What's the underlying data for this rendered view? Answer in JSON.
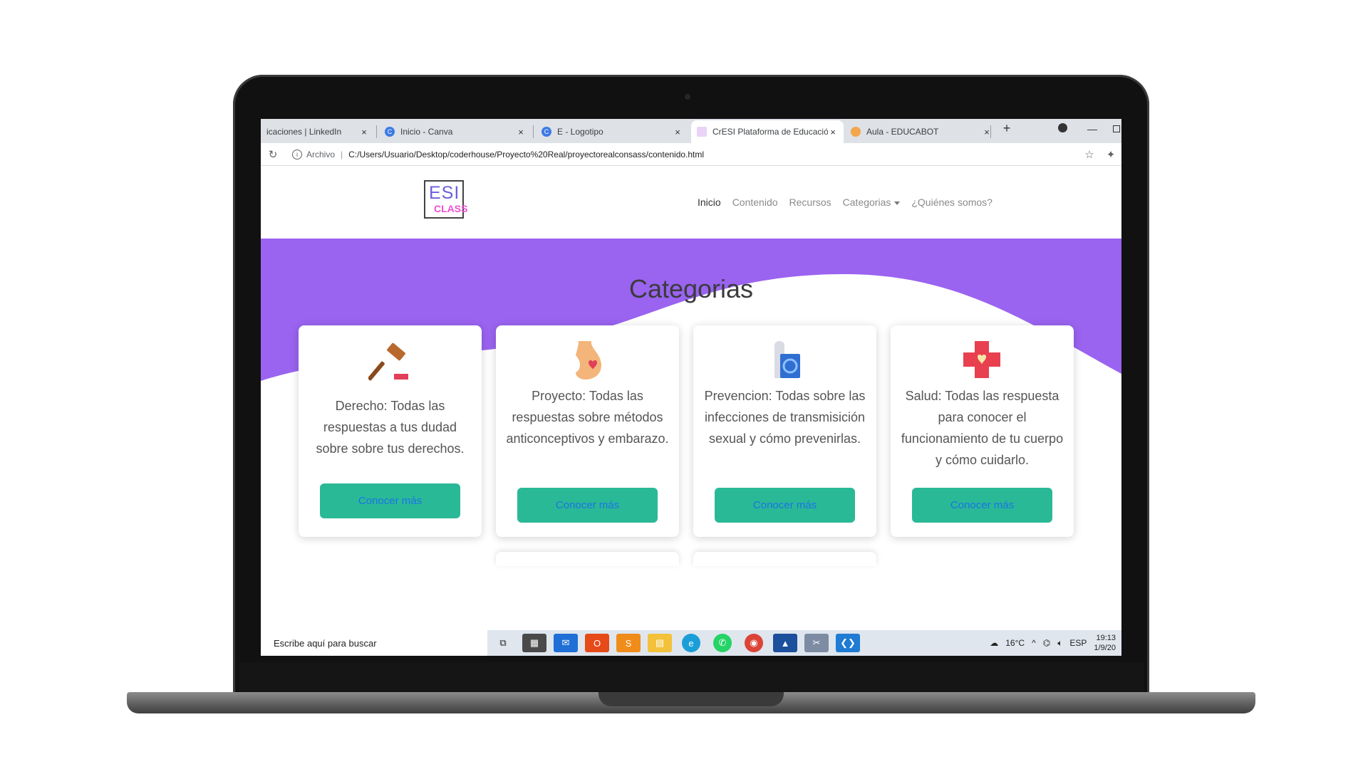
{
  "browser": {
    "tabs": [
      {
        "title": "icaciones | LinkedIn",
        "icon": "linkedin-icon"
      },
      {
        "title": "Inicio - Canva",
        "icon": "canva-icon"
      },
      {
        "title": "E - Logotipo",
        "icon": "canva-icon"
      },
      {
        "title": "CrESI Plataforma de Educació",
        "icon": "page-icon"
      },
      {
        "title": "Aula - EDUCABOT",
        "icon": "educabot-icon"
      }
    ],
    "close_glyph": "×",
    "new_tab": "+",
    "minimize": "—",
    "address": {
      "label": "Archivo",
      "url": "C:/Users/Usuario/Desktop/coderhouse/Proyecto%20Real/proyectorealconsass/contenido.html"
    }
  },
  "site": {
    "logo": {
      "line1": "ESI",
      "line2": "CLASS"
    },
    "nav": {
      "inicio": "Inicio",
      "contenido": "Contenido",
      "recursos": "Recursos",
      "categorias": "Categorias",
      "quienes": "¿Quiénes somos?"
    },
    "hero_color": "#9a63f0",
    "section_title": "Categorias",
    "cards": [
      {
        "icon": "gavel-icon",
        "text": "Derecho: Todas las respuestas a tus dudad sobre sobre tus derechos.",
        "button": "Conocer más"
      },
      {
        "icon": "pregnant-belly-icon",
        "text": "Proyecto: Todas las respuestas sobre métodos anticonceptivos y embarazo.",
        "button": "Conocer más"
      },
      {
        "icon": "condom-icon",
        "text": "Prevencion: Todas sobre las infecciones de transmisición sexual y cómo prevenirlas.",
        "button": "Conocer más"
      },
      {
        "icon": "health-cross-icon",
        "text": "Salud: Todas las respuesta para conocer el funcionamiento de tu cuerpo y cómo cuidarlo.",
        "button": "Conocer más"
      }
    ],
    "button_color": "#2ab996"
  },
  "taskbar": {
    "search_placeholder": "Escribe aquí para buscar",
    "apps": [
      "task-view-icon",
      "store-icon",
      "mail-icon",
      "office-icon",
      "sublime-icon",
      "file-explorer-icon",
      "edge-icon",
      "whatsapp-icon",
      "chrome-icon",
      "photos-icon",
      "snipping-icon",
      "vscode-icon"
    ],
    "temperature": "16°C",
    "language": "ESP",
    "time": "19:13",
    "date": "1/9/20"
  }
}
